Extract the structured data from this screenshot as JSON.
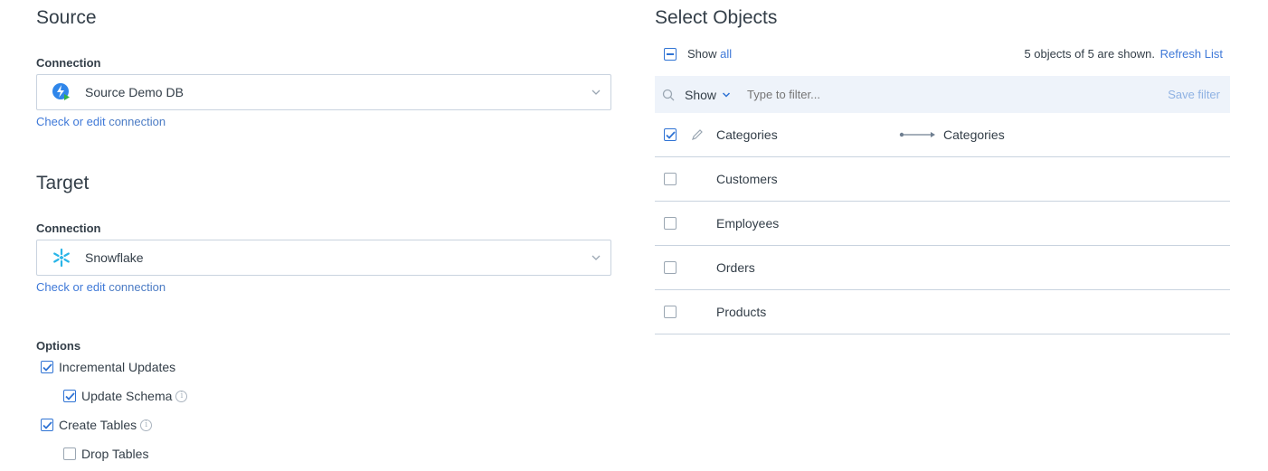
{
  "source": {
    "heading": "Source",
    "connection_label": "Connection",
    "connection_value": "Source Demo DB",
    "connection_icon": "bolt-icon",
    "check_link_a": "Check or edit",
    "check_link_b": " connection"
  },
  "target": {
    "heading": "Target",
    "connection_label": "Connection",
    "connection_value": "Snowflake",
    "connection_icon": "snowflake-icon",
    "check_link_a": "Check or edit",
    "check_link_b": " connection"
  },
  "options": {
    "heading": "Options",
    "items": [
      {
        "label": "Incremental Updates",
        "checked": true
      },
      {
        "label": "Update Schema",
        "checked": true
      },
      {
        "label": "Create Tables",
        "checked": true
      },
      {
        "label": "Drop Tables",
        "checked": false
      }
    ]
  },
  "objects": {
    "heading": "Select Objects",
    "show_label": "Show",
    "show_all_link": "all",
    "count_text": "5 objects of 5 are shown.",
    "refresh_link": "Refresh List",
    "filter_show": "Show",
    "filter_placeholder": "Type to filter...",
    "save_filter": "Save filter",
    "rows": [
      {
        "name": "Categories",
        "checked": true,
        "target": "Categories"
      },
      {
        "name": "Customers",
        "checked": false,
        "target": ""
      },
      {
        "name": "Employees",
        "checked": false,
        "target": ""
      },
      {
        "name": "Orders",
        "checked": false,
        "target": ""
      },
      {
        "name": "Products",
        "checked": false,
        "target": ""
      }
    ]
  },
  "colors": {
    "accent": "#2f73d4",
    "link": "#3f79d8",
    "border": "#c9d3df",
    "filter_bg": "#eef3fa"
  }
}
